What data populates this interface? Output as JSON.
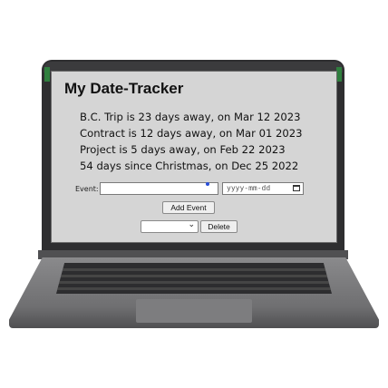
{
  "app": {
    "title": "My Date-Tracker"
  },
  "events": [
    {
      "text": "B.C. Trip is 23 days away, on Mar 12 2023"
    },
    {
      "text": "Contract is 12 days away, on Mar 01 2023"
    },
    {
      "text": "Project is 5 days away, on Feb 22 2023"
    },
    {
      "text": "54 days since Christmas, on Dec 25 2022"
    }
  ],
  "form": {
    "event_label": "Event:",
    "event_value": "",
    "date_placeholder": "yyyy-mm-dd",
    "add_label": "Add Event",
    "select_value": "",
    "delete_label": "Delete"
  },
  "icons": {
    "date": "calendar-icon",
    "select": "chevron-down-icon"
  },
  "colors": {
    "screen_bg": "#d5d5d5",
    "laptop_frame": "#2e2e30",
    "laptop_base": "#7a7a7c",
    "text": "#111111"
  }
}
